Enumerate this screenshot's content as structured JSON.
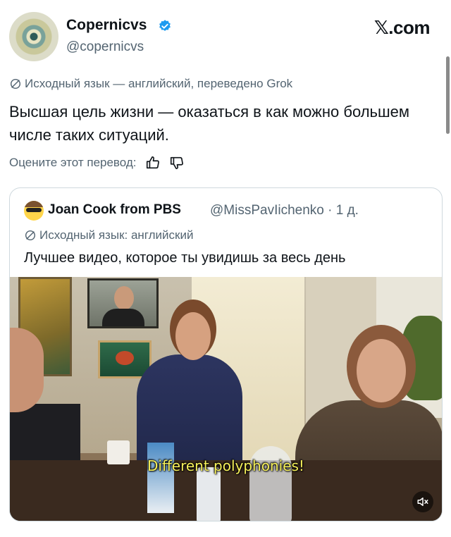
{
  "post": {
    "author_name": "Copernicvs",
    "handle": "@copernicvs",
    "verified": true,
    "brand": "𝕏.com",
    "translation_note": "Исходный язык — английский, переведено Grok",
    "text": "Высшая цель жизни — оказаться в как можно большем числе таких ситуаций.",
    "rate_label": "Оцените этот перевод:",
    "icons": [
      "avatar",
      "verified-badge-icon",
      "translate-icon",
      "thumbs-up-icon",
      "thumbs-down-icon"
    ]
  },
  "quote": {
    "author_name": "Joan Cook from PBS",
    "handle_time": "@MissPavIichenko · 1 д.",
    "translation_note": "Исходный язык: английский",
    "text": "Лучшее видео, которое ты увидишь за весь день",
    "video": {
      "subtitle": "Different polyphonies!",
      "mute_icon": "speaker-muted-icon"
    }
  },
  "colors": {
    "text": "#0f1419",
    "secondary": "#536471",
    "verified": "#1d9bf0",
    "border": "#cfd9de",
    "subtitle": "#f6f05a"
  }
}
